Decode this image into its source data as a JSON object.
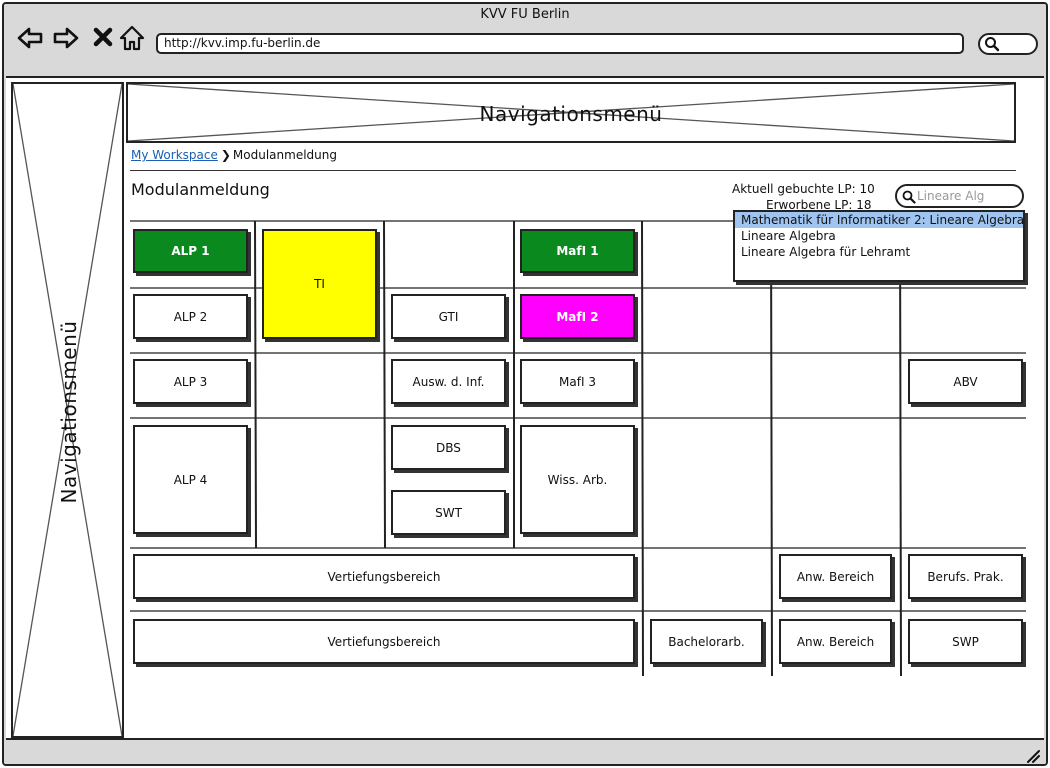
{
  "window": {
    "title": "KVV FU Berlin",
    "url": "http://kvv.imp.fu-berlin.de"
  },
  "nav": {
    "side_label": "Navigationsmenü",
    "top_label": "Navigationsmenü"
  },
  "breadcrumb": {
    "link": "My Workspace",
    "current": "Modulanmeldung"
  },
  "page": {
    "title": "Modulanmeldung",
    "lp_current": "Aktuell gebuchte LP: 10",
    "lp_earned": "Erworbene LP: 18"
  },
  "search": {
    "value": "Lineare Alg",
    "placeholder": "Lineare Alg"
  },
  "dropdown": {
    "items": [
      "Mathematik für Informatiker 2: Lineare Algebra",
      "Lineare Algebra",
      "Lineare Algebra für Lehramt"
    ],
    "selected_index": 0
  },
  "colors": {
    "completed": "#0a8a1e",
    "booked": "#ff00ff",
    "selected": "#ffff00",
    "highlight": "#9fc4f0"
  },
  "modules": {
    "alp1": "ALP 1",
    "alp2": "ALP 2",
    "alp3": "ALP 3",
    "alp4": "ALP 4",
    "ti": "TI",
    "gti": "GTI",
    "ausw": "Ausw. d. Inf.",
    "dbs": "DBS",
    "swt": "SWT",
    "mafi1": "MafI 1",
    "mafi2": "MafI 2",
    "mafi3": "MafI 3",
    "wiss": "Wiss. Arb.",
    "abv": "ABV",
    "vert1": "Vertiefungsbereich",
    "vert2": "Vertiefungsbereich",
    "anw1": "Anw. Bereich",
    "anw2": "Anw. Bereich",
    "berufs": "Berufs. Prak.",
    "bachelor": "Bachelorarb.",
    "swp": "SWP"
  }
}
